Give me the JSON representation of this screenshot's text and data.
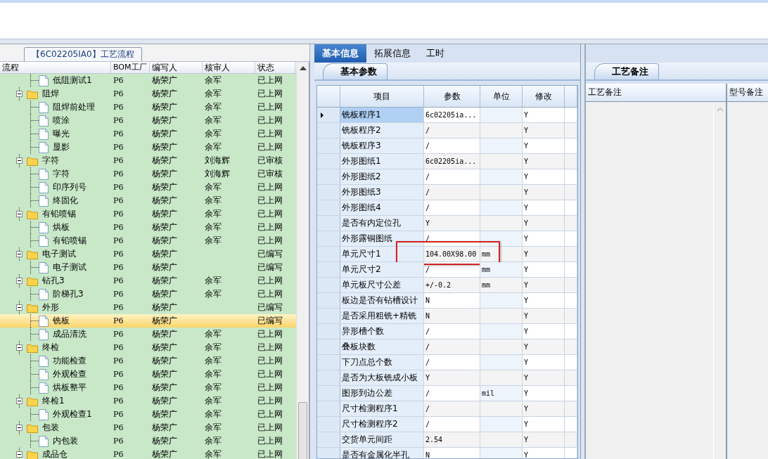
{
  "left_panel": {
    "title": "【6C02205IA0】工艺流程",
    "columns": [
      "流程",
      "BOM工厂",
      "编写人",
      "核审人",
      "状态"
    ],
    "tree": [
      {
        "kind": "file",
        "name": "低阻测试1",
        "factory": "P6",
        "writer": "杨荣广",
        "reviewer": "余军",
        "status": "已上网",
        "selected": false
      },
      {
        "kind": "folder",
        "expanded": true,
        "name": "阻焊",
        "factory": "P6",
        "writer": "杨荣广",
        "reviewer": "余军",
        "status": "已上网",
        "selected": false,
        "children": [
          {
            "kind": "file",
            "name": "阻焊前处理",
            "factory": "P6",
            "writer": "杨荣广",
            "reviewer": "余军",
            "status": "已上网",
            "selected": false
          },
          {
            "kind": "file",
            "name": "喷涂",
            "factory": "P6",
            "writer": "杨荣广",
            "reviewer": "余军",
            "status": "已上网",
            "selected": false
          },
          {
            "kind": "file",
            "name": "曝光",
            "factory": "P6",
            "writer": "杨荣广",
            "reviewer": "余军",
            "status": "已上网",
            "selected": false
          },
          {
            "kind": "file",
            "name": "显影",
            "factory": "P6",
            "writer": "杨荣广",
            "reviewer": "余军",
            "status": "已上网",
            "selected": false
          }
        ]
      },
      {
        "kind": "folder",
        "expanded": true,
        "name": "字符",
        "factory": "P6",
        "writer": "杨荣广",
        "reviewer": "刘海辉",
        "status": "已审核",
        "selected": false,
        "children": [
          {
            "kind": "file",
            "name": "字符",
            "factory": "P6",
            "writer": "杨荣广",
            "reviewer": "刘海辉",
            "status": "已审核",
            "selected": false
          },
          {
            "kind": "file",
            "name": "印序列号",
            "factory": "P6",
            "writer": "杨荣广",
            "reviewer": "余军",
            "status": "已上网",
            "selected": false
          },
          {
            "kind": "file",
            "name": "终固化",
            "factory": "P6",
            "writer": "杨荣广",
            "reviewer": "余军",
            "status": "已上网",
            "selected": false
          }
        ]
      },
      {
        "kind": "folder",
        "expanded": true,
        "name": "有铅喷锡",
        "factory": "P6",
        "writer": "杨荣广",
        "reviewer": "余军",
        "status": "已上网",
        "selected": false,
        "children": [
          {
            "kind": "file",
            "name": "烘板",
            "factory": "P6",
            "writer": "杨荣广",
            "reviewer": "余军",
            "status": "已上网",
            "selected": false
          },
          {
            "kind": "file",
            "name": "有铅喷锡",
            "factory": "P6",
            "writer": "杨荣广",
            "reviewer": "余军",
            "status": "已上网",
            "selected": false
          }
        ]
      },
      {
        "kind": "folder",
        "expanded": true,
        "name": "电子测试",
        "factory": "P6",
        "writer": "杨荣广",
        "status": "已编写",
        "selected": false,
        "children": [
          {
            "kind": "file",
            "name": "电子测试",
            "factory": "P6",
            "writer": "杨荣广",
            "status": "已编写",
            "selected": false
          }
        ]
      },
      {
        "kind": "folder",
        "expanded": true,
        "name": "钻孔3",
        "factory": "P6",
        "writer": "杨荣广",
        "reviewer": "余军",
        "status": "已上网",
        "selected": false,
        "children": [
          {
            "kind": "file",
            "name": "阶梯孔3",
            "factory": "P6",
            "writer": "杨荣广",
            "reviewer": "余军",
            "status": "已上网",
            "selected": false
          }
        ]
      },
      {
        "kind": "folder",
        "expanded": true,
        "name": "外形",
        "factory": "P6",
        "writer": "杨荣广",
        "status": "已编写",
        "selected": false,
        "children": [
          {
            "kind": "file",
            "name": "铣板",
            "factory": "P6",
            "writer": "杨荣广",
            "status": "已编写",
            "selected": true
          },
          {
            "kind": "file",
            "name": "成品清洗",
            "factory": "P6",
            "writer": "杨荣广",
            "reviewer": "余军",
            "status": "已上网",
            "selected": false
          }
        ]
      },
      {
        "kind": "folder",
        "expanded": true,
        "name": "终检",
        "factory": "P6",
        "writer": "杨荣广",
        "reviewer": "余军",
        "status": "已上网",
        "selected": false,
        "children": [
          {
            "kind": "file",
            "name": "功能检查",
            "factory": "P6",
            "writer": "杨荣广",
            "reviewer": "余军",
            "status": "已上网",
            "selected": false
          },
          {
            "kind": "file",
            "name": "外观检查",
            "factory": "P6",
            "writer": "杨荣广",
            "reviewer": "余军",
            "status": "已上网",
            "selected": false
          },
          {
            "kind": "file",
            "name": "烘板整平",
            "factory": "P6",
            "writer": "杨荣广",
            "reviewer": "余军",
            "status": "已上网",
            "selected": false
          }
        ]
      },
      {
        "kind": "folder",
        "expanded": true,
        "name": "终检1",
        "factory": "P6",
        "writer": "杨荣广",
        "reviewer": "余军",
        "status": "已上网",
        "selected": false,
        "children": [
          {
            "kind": "file",
            "name": "外观检查1",
            "factory": "P6",
            "writer": "杨荣广",
            "reviewer": "余军",
            "status": "已上网",
            "selected": false
          }
        ]
      },
      {
        "kind": "folder",
        "expanded": true,
        "name": "包装",
        "factory": "P6",
        "writer": "杨荣广",
        "reviewer": "余军",
        "status": "已上网",
        "selected": false,
        "children": [
          {
            "kind": "file",
            "name": "内包装",
            "factory": "P6",
            "writer": "杨荣广",
            "reviewer": "余军",
            "status": "已上网",
            "selected": false
          }
        ]
      },
      {
        "kind": "folder",
        "expanded": true,
        "name": "成品仓",
        "factory": "P6",
        "writer": "杨荣广",
        "reviewer": "余军",
        "status": "已上网",
        "selected": false
      }
    ]
  },
  "tabs": [
    {
      "label": "基本信息",
      "selected": true
    },
    {
      "label": "拓展信息",
      "selected": false
    },
    {
      "label": "工时",
      "selected": false
    }
  ],
  "params_panel": {
    "subtab": "基本参数",
    "columns": [
      "项目",
      "参数",
      "单位",
      "修改"
    ],
    "rows": [
      {
        "item": "铣板程序1",
        "param": "6c02205ia...",
        "modify": "Y",
        "selected": true,
        "highlighted": false
      },
      {
        "item": "铣板程序2",
        "param": "/",
        "modify": "Y",
        "selected": false,
        "highlighted": false
      },
      {
        "item": "铣板程序3",
        "param": "/",
        "modify": "Y",
        "selected": false,
        "highlighted": false
      },
      {
        "item": "外形图纸1",
        "param": "6c02205ia...",
        "modify": "Y",
        "selected": false,
        "highlighted": false
      },
      {
        "item": "外形图纸2",
        "param": "/",
        "modify": "Y",
        "selected": false,
        "highlighted": false
      },
      {
        "item": "外形图纸3",
        "param": "/",
        "modify": "Y",
        "selected": false,
        "highlighted": false
      },
      {
        "item": "外形图纸4",
        "param": "/",
        "modify": "Y",
        "selected": false,
        "highlighted": false
      },
      {
        "item": "是否有内定位孔",
        "param": "Y",
        "modify": "Y",
        "selected": false,
        "highlighted": false
      },
      {
        "item": "外形露铜图纸",
        "param": "/",
        "modify": "Y",
        "selected": false,
        "highlighted": false
      },
      {
        "item": "单元尺寸1",
        "param": "104.00X98.00",
        "unit": "mm",
        "modify": "Y",
        "selected": false,
        "highlighted": true
      },
      {
        "item": "单元尺寸2",
        "param": "/",
        "unit": "mm",
        "modify": "Y",
        "selected": false,
        "highlighted": false
      },
      {
        "item": "单元板尺寸公差",
        "param": "+/-0.2",
        "unit": "mm",
        "modify": "Y",
        "selected": false,
        "highlighted": false
      },
      {
        "item": "板边是否有钻槽设计",
        "param": "N",
        "modify": "Y",
        "selected": false,
        "highlighted": false
      },
      {
        "item": "是否采用粗铣+精铣",
        "param": "N",
        "modify": "Y",
        "selected": false,
        "highlighted": false
      },
      {
        "item": "异形槽个数",
        "param": "/",
        "modify": "Y",
        "selected": false,
        "highlighted": false
      },
      {
        "item": "叠板块数",
        "param": "/",
        "modify": "Y",
        "selected": false,
        "highlighted": false
      },
      {
        "item": "下刀点总个数",
        "param": "/",
        "modify": "Y",
        "selected": false,
        "highlighted": false
      },
      {
        "item": "是否为大板铣成小板",
        "param": "Y",
        "modify": "Y",
        "selected": false,
        "highlighted": false
      },
      {
        "item": "图形到边公差",
        "param": "/",
        "unit": "mil",
        "modify": "Y",
        "selected": false,
        "highlighted": false
      },
      {
        "item": "尺寸检测程序1",
        "param": "/",
        "modify": "Y",
        "selected": false,
        "highlighted": false
      },
      {
        "item": "尺寸检测程序2",
        "param": "/",
        "modify": "Y",
        "selected": false,
        "highlighted": false
      },
      {
        "item": "交货单元间距",
        "param": "2.54",
        "modify": "Y",
        "selected": false,
        "highlighted": false
      },
      {
        "item": "是否有金属化半孔",
        "param": "N",
        "modify": "Y",
        "selected": false,
        "highlighted": false
      }
    ]
  },
  "notes_panel": {
    "subtab": "工艺备注",
    "columns": [
      "工艺备注",
      "型号备注"
    ]
  }
}
